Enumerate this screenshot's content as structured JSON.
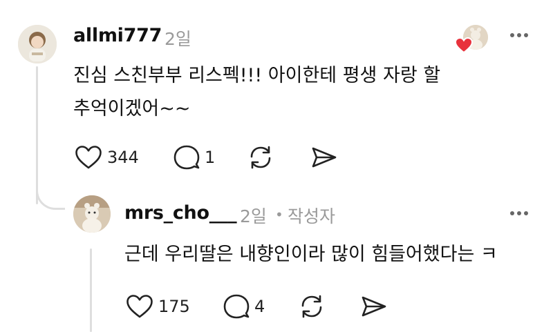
{
  "comment": {
    "username": "allmi777",
    "time": "2일",
    "lines": [
      "진심  스친부부 리스펙!!! 아이한테 평생 자랑 할",
      "추억이겠어~~"
    ],
    "like_count": "344",
    "reply_count": "1"
  },
  "reply": {
    "username": "mrs_cho___",
    "time": "2일",
    "separator": "•",
    "author_tag": "작성자",
    "text": "근데 우리딸은 내향인이라 많이 힘들어했다는 ㅋ",
    "like_count": "175",
    "reply_count": "4"
  },
  "icons": {
    "more": "more-horizontal-icon",
    "like": "heart-icon",
    "reply": "comment-bubble-icon",
    "repost": "repost-icon",
    "share": "send-icon",
    "liked_by_author": "red-heart-badge"
  },
  "colors": {
    "text": "#111111",
    "muted": "#9a9a9a",
    "heart_badge": "#e8323c",
    "thread_line": "#dedede"
  }
}
